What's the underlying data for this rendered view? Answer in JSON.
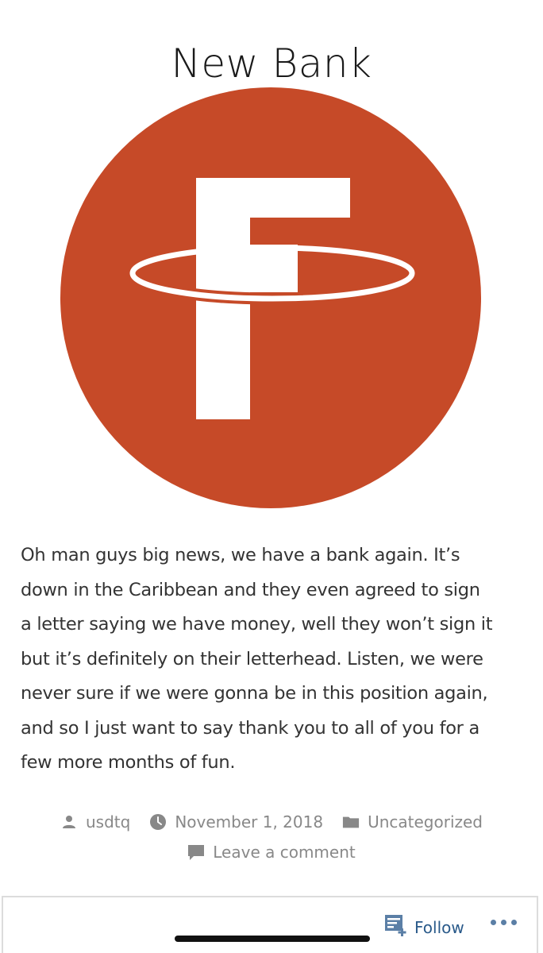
{
  "post": {
    "title": "New Bank",
    "logo": {
      "icon": "tether-f-logo-icon",
      "circle_color": "#c64a28",
      "glyph_color": "#ffffff"
    },
    "body_lines": [
      "Oh man guys big news, we have a bank again. It’s",
      "down in the Caribbean and they even agreed to sign",
      "a letter saying we have money, well they won’t sign it",
      "but it’s definitely on their letterhead. Listen, we were",
      "never sure if we were gonna be in this position again,",
      "and so I just want to say thank you to all of you for a",
      "few more months of fun."
    ]
  },
  "meta": {
    "author": "usdtq",
    "author_icon": "person-icon",
    "date": "November 1, 2018",
    "date_icon": "clock-icon",
    "category": "Uncategorized",
    "category_icon": "folder-icon",
    "comment_link": "Leave a comment",
    "comment_icon": "speech-bubble-icon",
    "text_color": "#888888"
  },
  "follow_bar": {
    "follow_label": "Follow",
    "follow_icon": "reader-follow-icon",
    "more_icon": "ellipsis-icon",
    "accent_color": "#2a5a8a"
  }
}
